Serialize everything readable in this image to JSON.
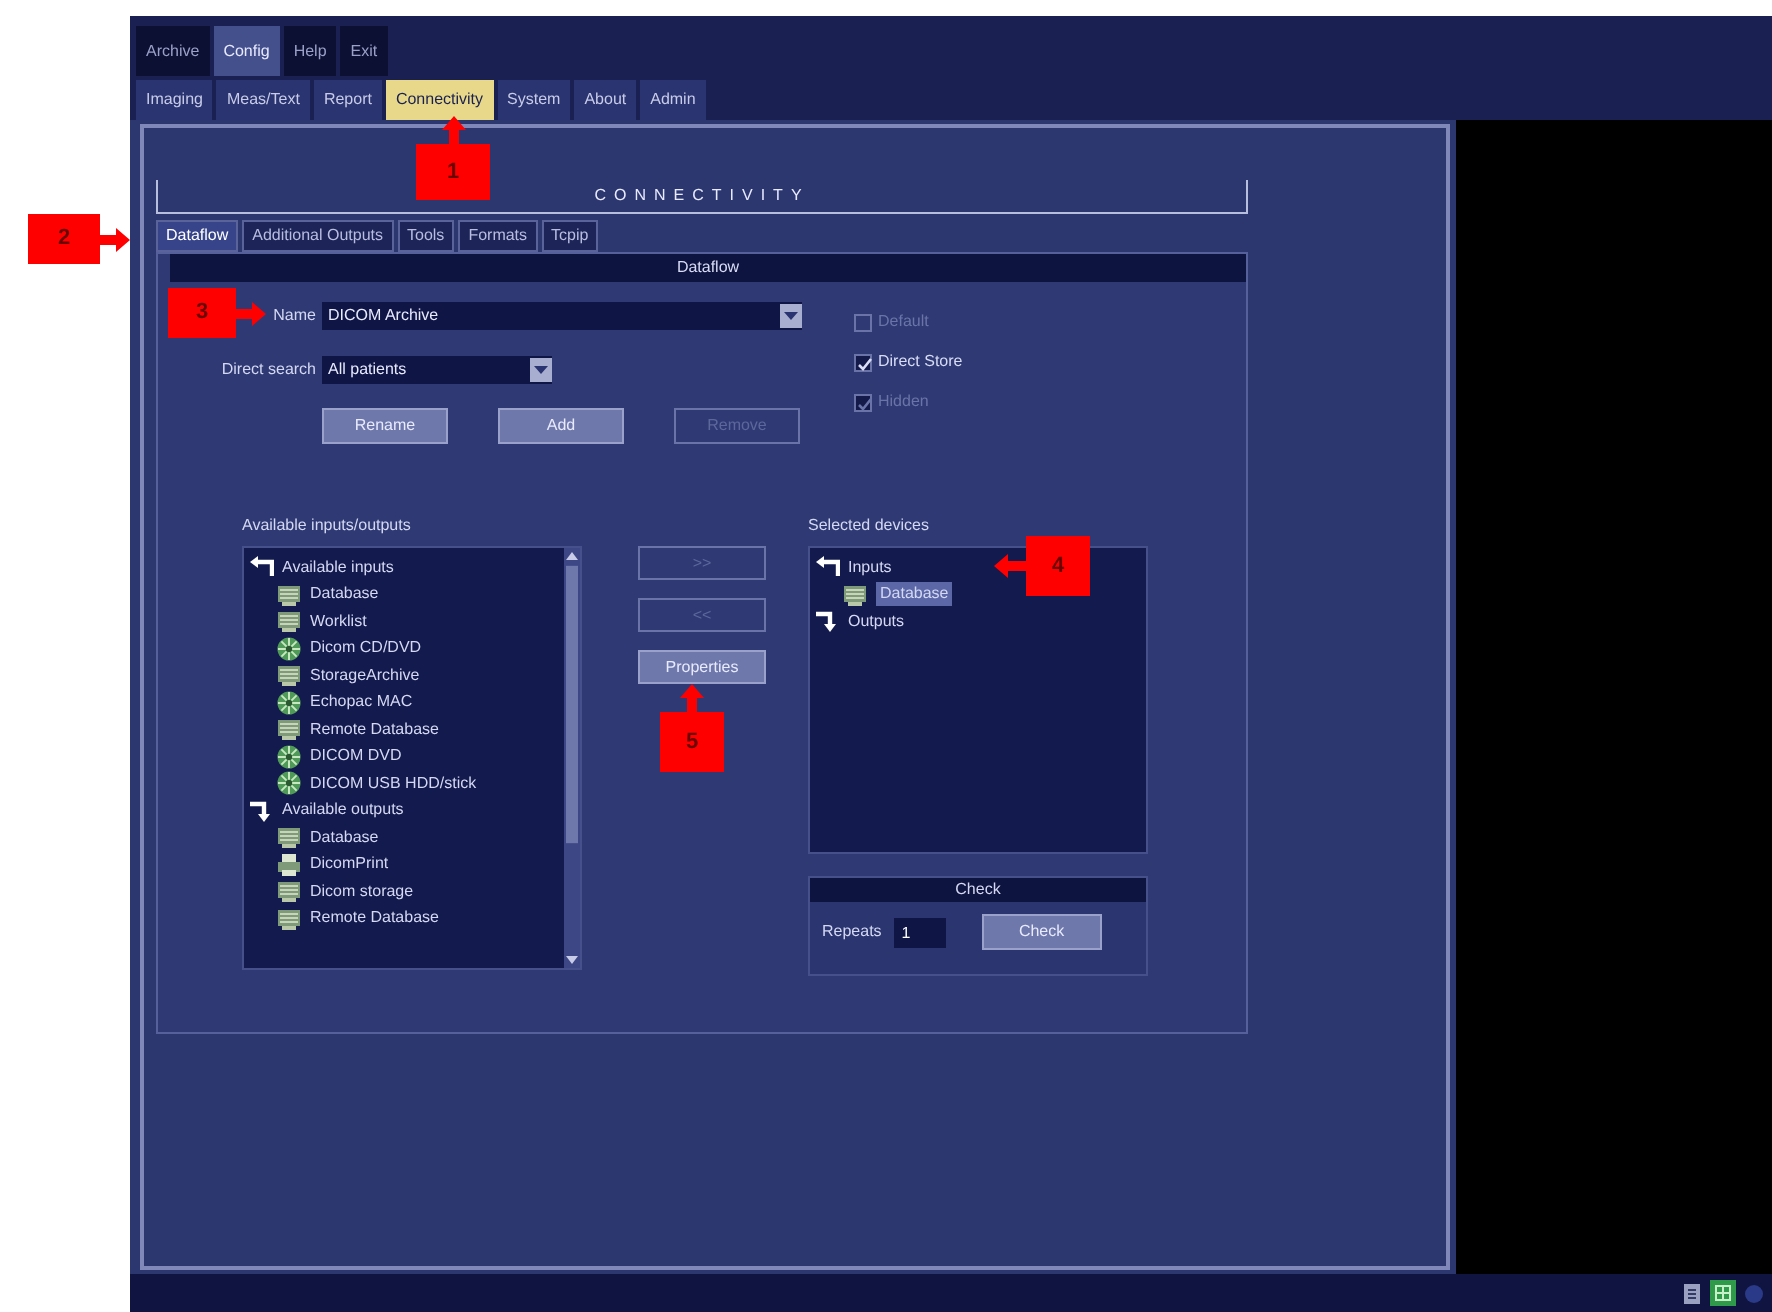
{
  "menu": [
    {
      "label": "Archive",
      "selected": false
    },
    {
      "label": "Config",
      "selected": true
    },
    {
      "label": "Help",
      "selected": false
    },
    {
      "label": "Exit",
      "selected": false
    }
  ],
  "config_tabs": [
    {
      "label": "Imaging",
      "selected": false
    },
    {
      "label": "Meas/Text",
      "selected": false
    },
    {
      "label": "Report",
      "selected": false
    },
    {
      "label": "Connectivity",
      "selected": true
    },
    {
      "label": "System",
      "selected": false
    },
    {
      "label": "About",
      "selected": false
    },
    {
      "label": "Admin",
      "selected": false
    }
  ],
  "section_title": "CONNECTIVITY",
  "sub_tabs": [
    {
      "label": "Dataflow",
      "selected": true
    },
    {
      "label": "Additional Outputs",
      "selected": false
    },
    {
      "label": "Tools",
      "selected": false
    },
    {
      "label": "Formats",
      "selected": false
    },
    {
      "label": "Tcpip",
      "selected": false
    }
  ],
  "dataflow": {
    "title": "Dataflow",
    "name_label": "Name",
    "name_value": "DICOM Archive",
    "direct_search_label": "Direct search",
    "direct_search_value": "All patients",
    "buttons": [
      {
        "label": "Rename",
        "disabled": false
      },
      {
        "label": "Add",
        "disabled": false
      },
      {
        "label": "Remove",
        "disabled": true
      }
    ],
    "options": [
      {
        "label": "Default",
        "checked": false,
        "disabled": true
      },
      {
        "label": "Direct Store",
        "checked": true,
        "disabled": false
      },
      {
        "label": "Hidden",
        "checked": true,
        "disabled": true
      }
    ]
  },
  "available": {
    "label": "Available inputs/outputs",
    "items": [
      {
        "label": "Available inputs",
        "kind": "input-group",
        "children": [
          {
            "label": "Database",
            "kind": "drive"
          },
          {
            "label": "Worklist",
            "kind": "drive"
          },
          {
            "label": "Dicom CD/DVD",
            "kind": "disc"
          },
          {
            "label": "StorageArchive",
            "kind": "drive"
          },
          {
            "label": "Echopac MAC",
            "kind": "disc"
          },
          {
            "label": "Remote Database",
            "kind": "drive"
          },
          {
            "label": "DICOM DVD",
            "kind": "disc"
          },
          {
            "label": "DICOM USB HDD/stick",
            "kind": "disc"
          }
        ]
      },
      {
        "label": "Available outputs",
        "kind": "output-group",
        "children": [
          {
            "label": "Database",
            "kind": "drive"
          },
          {
            "label": "DicomPrint",
            "kind": "printer"
          },
          {
            "label": "Dicom storage",
            "kind": "drive"
          },
          {
            "label": "Remote Database",
            "kind": "drive"
          }
        ]
      }
    ]
  },
  "move_buttons": [
    {
      "label": ">>",
      "disabled": true
    },
    {
      "label": "<<",
      "disabled": true
    },
    {
      "label": "Properties",
      "disabled": false
    }
  ],
  "selected_devices": {
    "label": "Selected devices",
    "items": [
      {
        "label": "Inputs",
        "kind": "input-group",
        "selected": false,
        "children": [
          {
            "label": "Database",
            "kind": "drive",
            "selected": true
          }
        ]
      },
      {
        "label": "Outputs",
        "kind": "output-group",
        "selected": false
      }
    ]
  },
  "check": {
    "title": "Check",
    "repeats_label": "Repeats",
    "repeats_value": "1",
    "button": "Check"
  },
  "callouts": [
    {
      "number": "1",
      "kind": "up"
    },
    {
      "number": "2",
      "kind": "right"
    },
    {
      "number": "3",
      "kind": "right"
    },
    {
      "number": "4",
      "kind": "left"
    },
    {
      "number": "5",
      "kind": "up"
    }
  ]
}
